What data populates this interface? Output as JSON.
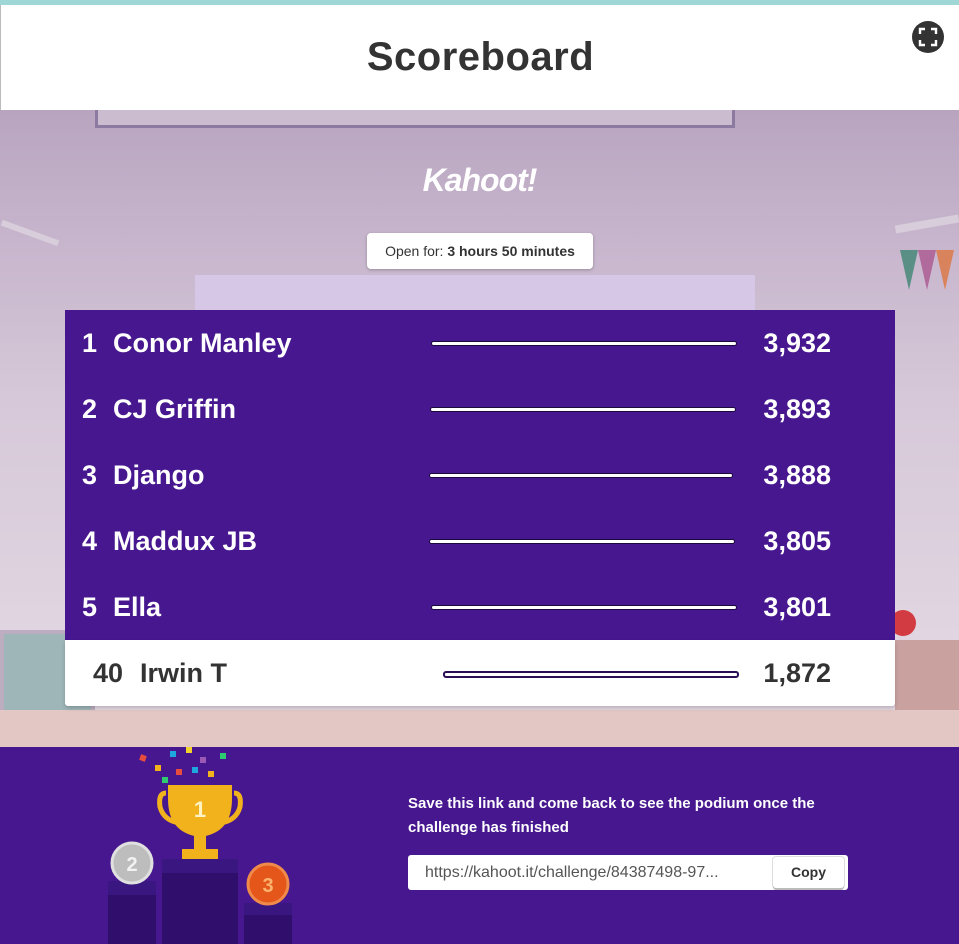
{
  "header": {
    "title": "Scoreboard"
  },
  "brand": {
    "logo_text": "Kahoot!"
  },
  "open_for": {
    "label": "Open for:",
    "value": "3 hours 50 minutes"
  },
  "leaderboard": {
    "rows": [
      {
        "rank": "1",
        "name": "Conor Manley",
        "score": "3,932"
      },
      {
        "rank": "2",
        "name": "CJ Griffin",
        "score": "3,893"
      },
      {
        "rank": "3",
        "name": "Django",
        "score": "3,888"
      },
      {
        "rank": "4",
        "name": "Maddux JB",
        "score": "3,805"
      },
      {
        "rank": "5",
        "name": "Ella",
        "score": "3,801"
      }
    ],
    "current_player": {
      "rank": "40",
      "name": "Irwin T",
      "score": "1,872"
    }
  },
  "footer": {
    "save_text": "Save this link and come back to see the podium once the challenge has finished",
    "link": "https://kahoot.it/challenge/84387498-97...",
    "copy_label": "Copy",
    "podium_places": [
      "1",
      "2",
      "3"
    ]
  },
  "colors": {
    "purple": "#46178f",
    "gold": "#f2b21c",
    "silver": "#bdbdbd",
    "bronze": "#e5561b"
  }
}
